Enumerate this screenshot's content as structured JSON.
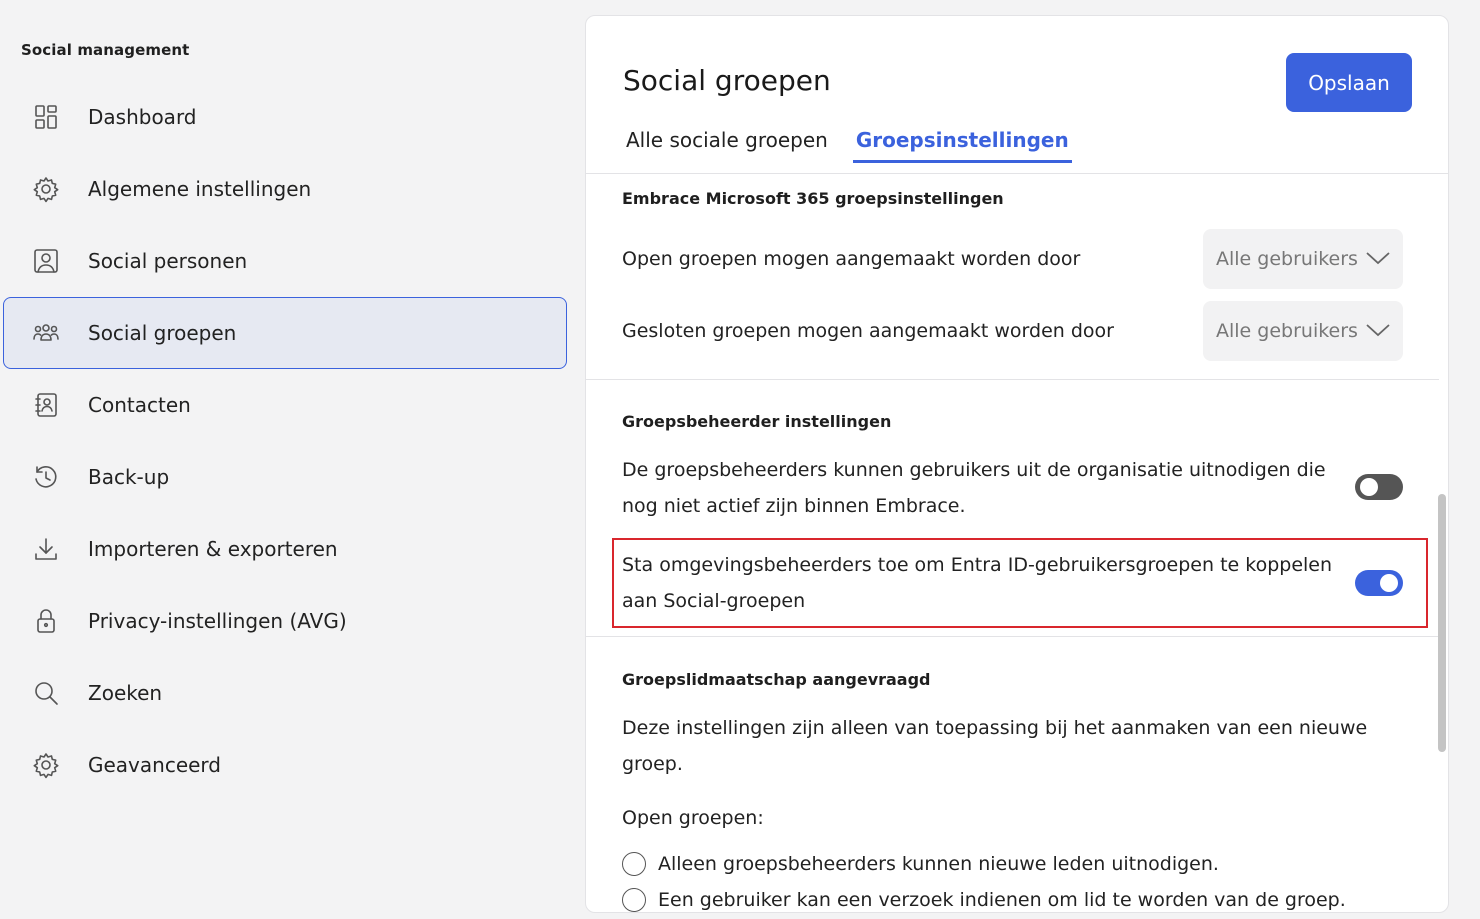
{
  "sidebar": {
    "title": "Social management",
    "items": [
      {
        "label": "Dashboard",
        "icon": "dashboard-icon"
      },
      {
        "label": "Algemene instellingen",
        "icon": "gear-icon"
      },
      {
        "label": "Social personen",
        "icon": "person-icon"
      },
      {
        "label": "Social groepen",
        "icon": "group-icon",
        "active": true
      },
      {
        "label": "Contacten",
        "icon": "contacts-icon"
      },
      {
        "label": "Back-up",
        "icon": "history-icon"
      },
      {
        "label": "Importeren & exporteren",
        "icon": "download-icon"
      },
      {
        "label": "Privacy-instellingen (AVG)",
        "icon": "lock-icon"
      },
      {
        "label": "Zoeken",
        "icon": "search-icon"
      },
      {
        "label": "Geavanceerd",
        "icon": "gear-icon"
      }
    ]
  },
  "main": {
    "title": "Social groepen",
    "save_label": "Opslaan",
    "tabs": [
      {
        "label": "Alle sociale groepen",
        "active": false
      },
      {
        "label": "Groepsinstellingen",
        "active": true
      }
    ],
    "sections": {
      "ms365": {
        "title": "Embrace Microsoft 365 groepsinstellingen",
        "open_label": "Open groepen mogen aangemaakt worden door",
        "open_value": "Alle gebruikers",
        "closed_label": "Gesloten groepen mogen aangemaakt worden door",
        "closed_value": "Alle gebruikers"
      },
      "admin": {
        "title": "Groepsbeheerder instellingen",
        "invite_line1": "De groepsbeheerders kunnen gebruikers uit de organisatie uitnodigen die",
        "invite_line2": "nog niet actief zijn binnen Embrace.",
        "invite_enabled": false,
        "entra_line1": "Sta omgevingsbeheerders toe om Entra ID-gebruikersgroepen te koppelen",
        "entra_line2": "aan Social-groepen",
        "entra_enabled": true
      },
      "membership": {
        "title": "Groepslidmaatschap aangevraagd",
        "desc_line1": "Deze instellingen zijn alleen van toepassing bij het aanmaken van een nieuwe",
        "desc_line2": "groep.",
        "open_groups_label": "Open groepen:",
        "option1": "Alleen groepsbeheerders kunnen nieuwe leden uitnodigen.",
        "option2": "Een gebruiker kan een verzoek indienen om lid te worden van de groep."
      }
    }
  },
  "colors": {
    "accent": "#3b62dd",
    "highlight": "#d9262d",
    "toggle_off": "#555555"
  }
}
